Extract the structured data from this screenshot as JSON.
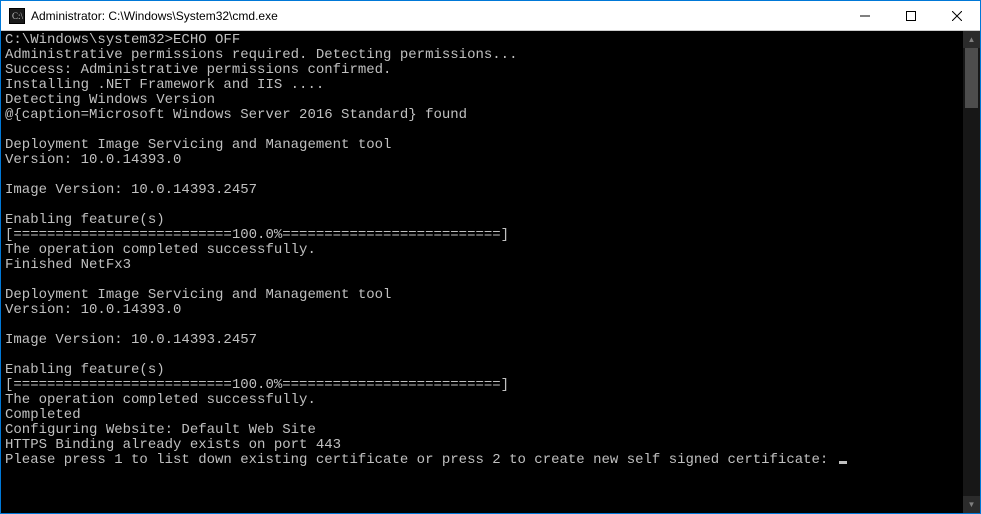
{
  "titlebar": {
    "title": "Administrator: C:\\Windows\\System32\\cmd.exe"
  },
  "window_controls": {
    "minimize": "—",
    "maximize": "☐",
    "close": "✕"
  },
  "terminal": {
    "lines": [
      "C:\\Windows\\system32>ECHO OFF",
      "Administrative permissions required. Detecting permissions...",
      "Success: Administrative permissions confirmed.",
      "Installing .NET Framework and IIS ....",
      "Detecting Windows Version",
      "@{caption=Microsoft Windows Server 2016 Standard} found",
      "",
      "Deployment Image Servicing and Management tool",
      "Version: 10.0.14393.0",
      "",
      "Image Version: 10.0.14393.2457",
      "",
      "Enabling feature(s)",
      "[==========================100.0%==========================]",
      "The operation completed successfully.",
      "Finished NetFx3",
      "",
      "Deployment Image Servicing and Management tool",
      "Version: 10.0.14393.0",
      "",
      "Image Version: 10.0.14393.2457",
      "",
      "Enabling feature(s)",
      "[==========================100.0%==========================]",
      "The operation completed successfully.",
      "Completed",
      "Configuring Website: Default Web Site",
      "HTTPS Binding already exists on port 443",
      "Please press 1 to list down existing certificate or press 2 to create new self signed certificate: "
    ]
  },
  "scrollbar": {
    "up_arrow": "▲",
    "down_arrow": "▼"
  }
}
